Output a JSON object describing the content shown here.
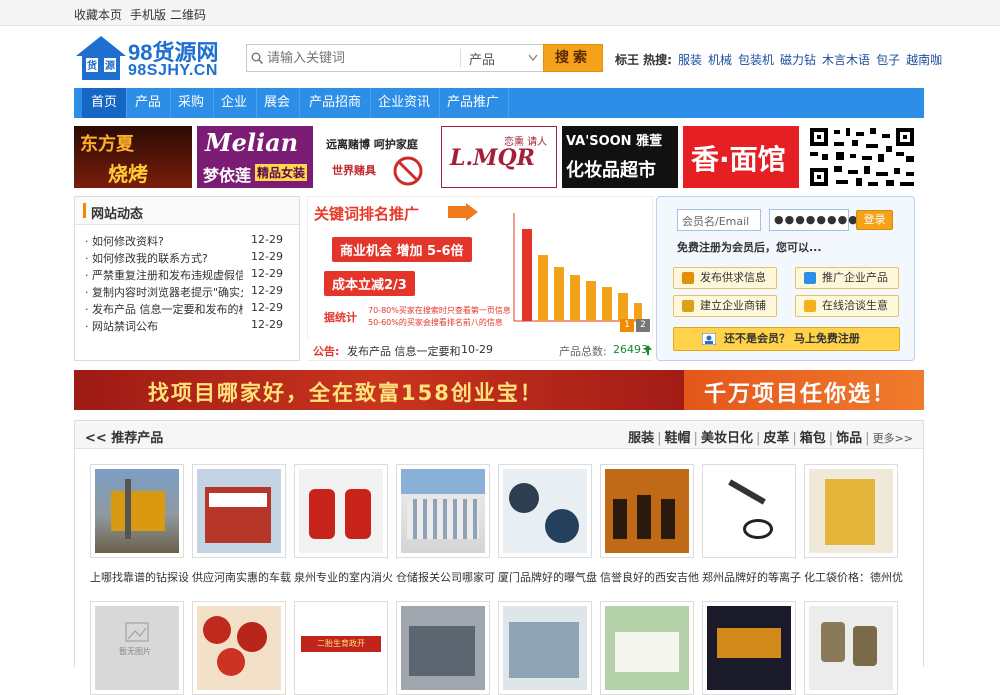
{
  "topbar": {
    "bookmark": "收藏本页",
    "mobile": "手机版",
    "qrcode": "二维码"
  },
  "logo": {
    "main": "98货源网",
    "sub": "98SJHY.CN",
    "house_left": "货",
    "house_right": "源"
  },
  "search": {
    "placeholder": "请输入关键词",
    "category": "产品",
    "button": "搜索"
  },
  "hot": {
    "label": "标王 热搜:",
    "items": [
      "服装",
      "机械",
      "包装机",
      "磁力钻",
      "木言木语",
      "包子",
      "越南咖"
    ]
  },
  "nav": {
    "items": [
      "首页",
      "产品",
      "采购",
      "企业",
      "展会",
      "产品招商",
      "企业资讯",
      "产品推广"
    ],
    "active": 0
  },
  "ads": {
    "a1_top": "东方夏",
    "a1_bottom": "烧烤",
    "a2_top": "Melian",
    "a2_bottom": "梦依莲",
    "a2_tag": "精品女装",
    "a3_top": "远离赌博 呵护家庭",
    "a3_bottom": "世界赌具",
    "a4_main": "L.MQR",
    "a4_tag": "恋熏 请人",
    "a5_top": "VA'SOON 雅萱",
    "a5_bottom": "化妆品超市",
    "a6": "香·面馆"
  },
  "news": {
    "title": "网站动态",
    "rows": [
      {
        "title": "如何修改资料?",
        "date": "12-29"
      },
      {
        "title": "如何修改我的联系方式?",
        "date": "12-29"
      },
      {
        "title": "严禁重复注册和发布违规虚假信",
        "date": "12-29"
      },
      {
        "title": "复制内容时浏览器老提示\"确实允",
        "date": "12-29"
      },
      {
        "title": "发布产品 信息一定要和发布的栏",
        "date": "12-29"
      },
      {
        "title": "网站禁词公布",
        "date": "12-29"
      }
    ]
  },
  "promo": {
    "title": "关键词排名推广",
    "pill1": "商业机会 增加 5-6倍",
    "pill2": "成本立减2/3",
    "stat_label": "据统计",
    "stat1": "70-80%买家在搜索时只查看第一页信息",
    "stat2": "50-60%的买家会搜看排名前八的信息",
    "pages": [
      "1",
      "2"
    ]
  },
  "notice": {
    "label": "公告:",
    "text": "发布产品 信息一定要和",
    "date": "10-29",
    "total_label": "产品总数:",
    "total": "26493"
  },
  "login": {
    "user_placeholder": "会员名/Email",
    "password": "●●●●●●●●",
    "login_button": "登录",
    "hint": "免费注册为会员后，您可以...",
    "actions": [
      "发布供求信息",
      "推广企业产品",
      "建立企业商铺",
      "在线洽谈生意"
    ],
    "register": "还不是会员？ 马上免费注册"
  },
  "banner": {
    "left": "找项目哪家好，全在致富158创业宝！",
    "right": "千万项目任你选！"
  },
  "products": {
    "title": "<< 推荐产品",
    "categories": [
      "服装",
      "鞋帽",
      "美妆日化",
      "皮革",
      "箱包",
      "饰品"
    ],
    "more": "更多>>",
    "row1": [
      "上哪找靠谱的钻探设",
      "供应河南实惠的车载",
      "泉州专业的室内消火",
      "仓储报关公司哪家可",
      "厦门品牌好的曝气盘",
      "信誉良好的西安吉他",
      "郑州品牌好的等离子",
      "化工袋价格：德州优"
    ],
    "placeholder_text": "暂无图片",
    "ad_text": "二胎生育政开"
  },
  "colors": {
    "nav": "#2d8ee8",
    "accent": "#f5a21b",
    "brand": "#1e6fd0",
    "banner": "#b7241d"
  }
}
